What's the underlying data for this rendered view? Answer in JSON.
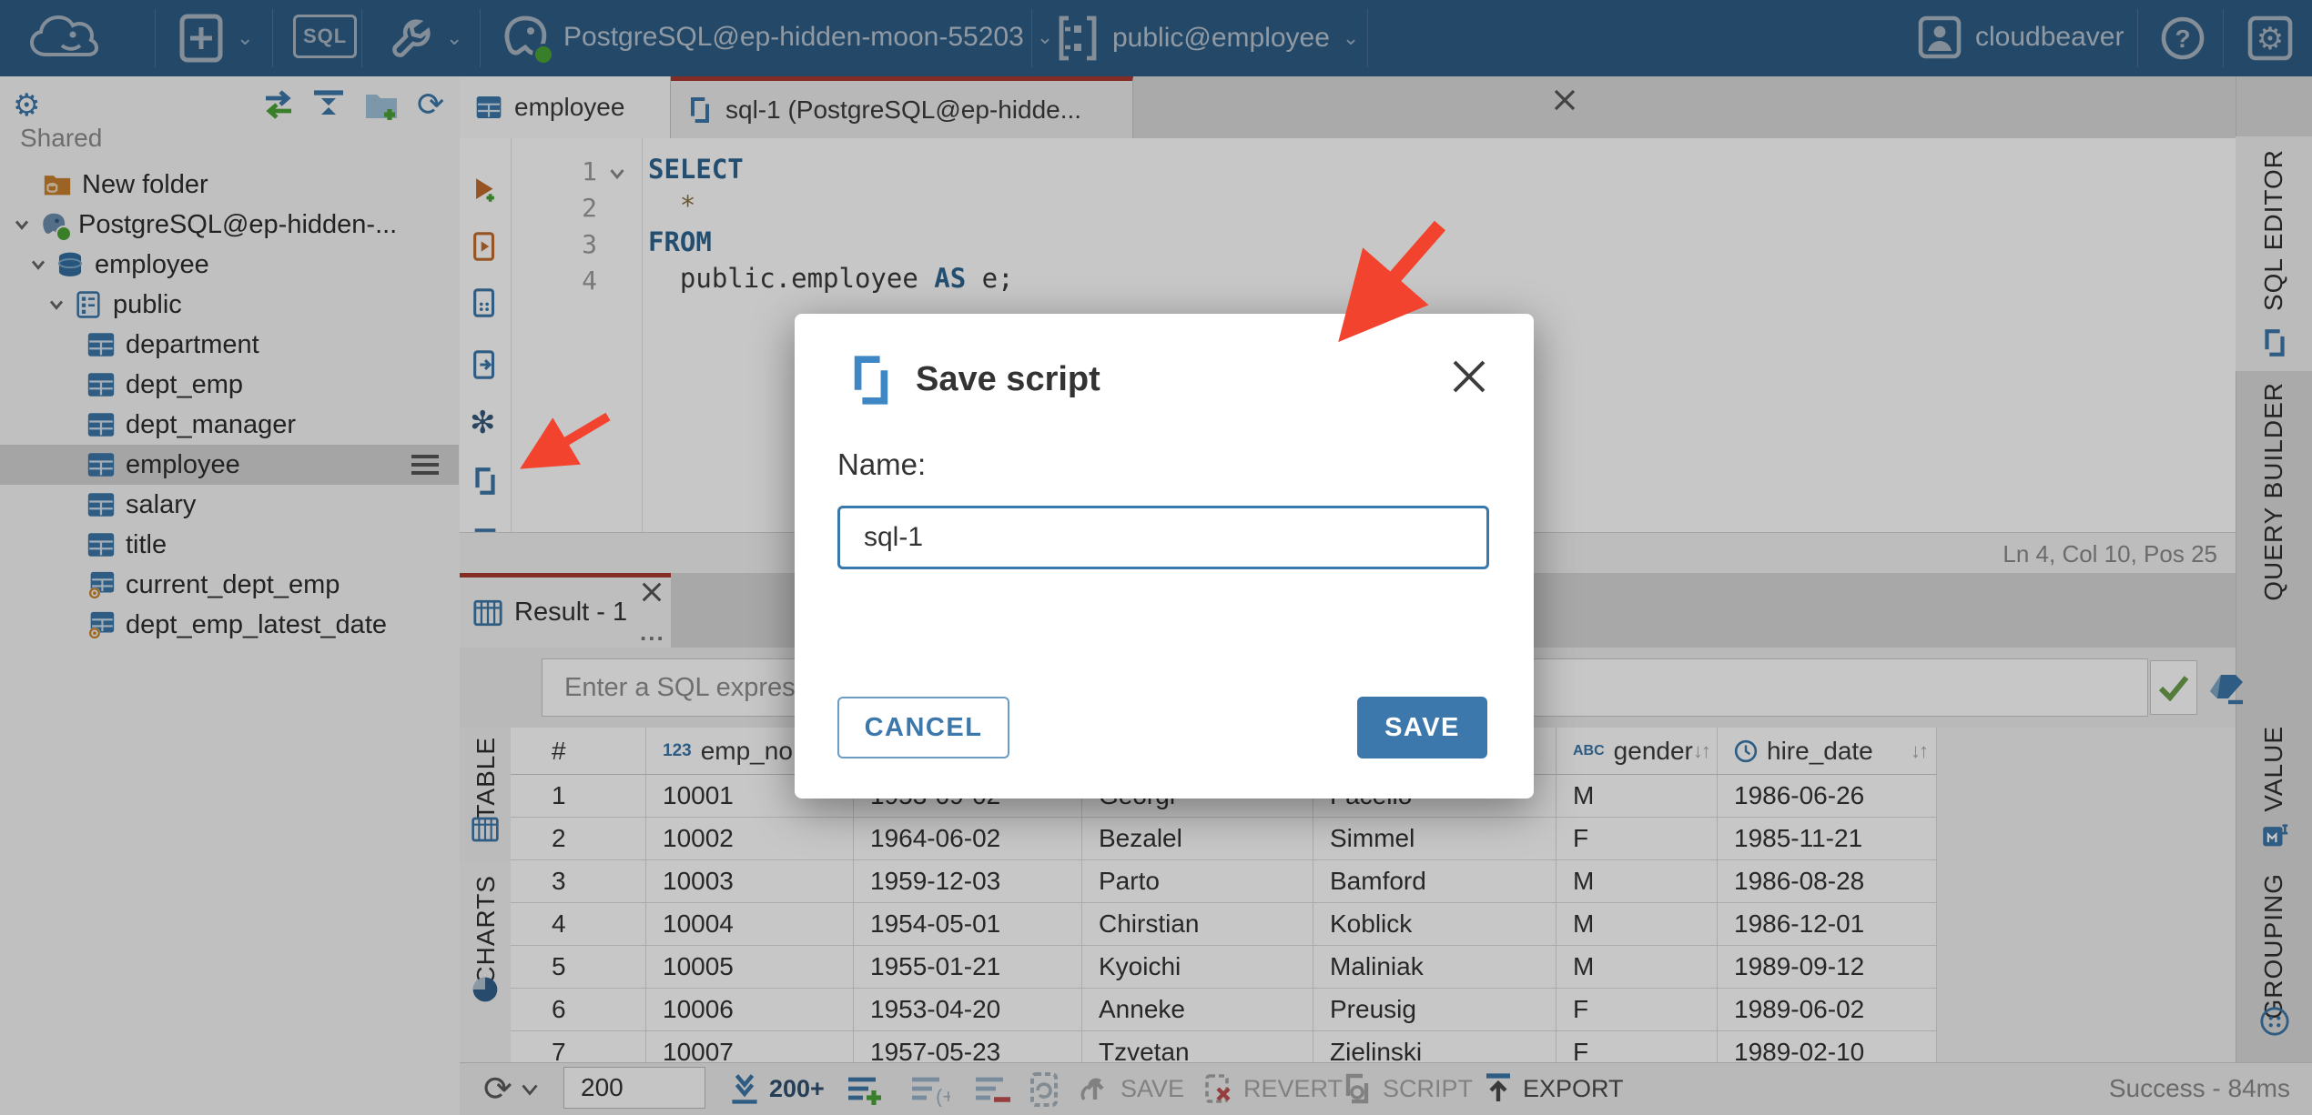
{
  "colors": {
    "accent": "#3c78ab",
    "topbar": "#2f5d86",
    "tab_indicator": "#a83a31",
    "status_green": "#4aa336",
    "arrow_red": "#f2432f"
  },
  "topbar": {
    "sql_badge": "SQL",
    "connection": "PostgreSQL@ep-hidden-moon-55203",
    "schema": "public@employee",
    "user": "cloudbeaver"
  },
  "sidebar": {
    "section_label": "Shared",
    "tree": [
      {
        "label": "New folder",
        "type": "folder"
      },
      {
        "label": "PostgreSQL@ep-hidden-...",
        "type": "connection",
        "expanded": true
      },
      {
        "label": "employee",
        "type": "database",
        "expanded": true
      },
      {
        "label": "public",
        "type": "schema",
        "expanded": true
      },
      {
        "label": "department",
        "type": "table"
      },
      {
        "label": "dept_emp",
        "type": "table"
      },
      {
        "label": "dept_manager",
        "type": "table"
      },
      {
        "label": "employee",
        "type": "table",
        "selected": true
      },
      {
        "label": "salary",
        "type": "table"
      },
      {
        "label": "title",
        "type": "table"
      },
      {
        "label": "current_dept_emp",
        "type": "view"
      },
      {
        "label": "dept_emp_latest_date",
        "type": "view"
      }
    ]
  },
  "editor_tabs": {
    "tab1": "employee",
    "tab2": "sql-1 (PostgreSQL@ep-hidde...",
    "menu_dots": "..."
  },
  "editor": {
    "line_numbers": [
      "1",
      "2",
      "3",
      "4"
    ],
    "kw_select": "SELECT",
    "star": "*",
    "kw_from": "FROM",
    "l4_plain1": "public.employee ",
    "kw_as": "AS",
    "l4_plain2": " e;",
    "status": "Ln 4, Col 10, Pos 25"
  },
  "result": {
    "tab_label": "Result - 1",
    "menu_dots": "...",
    "filter_placeholder": "Enter a SQL expressi",
    "table_tab": "TABLE",
    "charts_tab": "CHARTS"
  },
  "grid": {
    "headers": {
      "rownum": "#",
      "emp_no_type": "123",
      "emp_no": "emp_no",
      "gender_type": "ABC",
      "gender": "gender",
      "hire_date": "hire_date",
      "sort_glyph": "↓↑"
    },
    "rows": [
      [
        "1",
        "10001",
        "1953-09-02",
        "Georgi",
        "Facello",
        "M",
        "1986-06-26"
      ],
      [
        "2",
        "10002",
        "1964-06-02",
        "Bezalel",
        "Simmel",
        "F",
        "1985-11-21"
      ],
      [
        "3",
        "10003",
        "1959-12-03",
        "Parto",
        "Bamford",
        "M",
        "1986-08-28"
      ],
      [
        "4",
        "10004",
        "1954-05-01",
        "Chirstian",
        "Koblick",
        "M",
        "1986-12-01"
      ],
      [
        "5",
        "10005",
        "1955-01-21",
        "Kyoichi",
        "Maliniak",
        "M",
        "1989-09-12"
      ],
      [
        "6",
        "10006",
        "1953-04-20",
        "Anneke",
        "Preusig",
        "F",
        "1989-06-02"
      ],
      [
        "7",
        "10007",
        "1957-05-23",
        "Tzvetan",
        "Zielinski",
        "F",
        "1989-02-10"
      ]
    ]
  },
  "right_tabs": {
    "sql_editor": "SQL EDITOR",
    "query_builder": "QUERY BUILDER",
    "value": "VALUE",
    "grouping": "GROUPING"
  },
  "toolbar": {
    "rows_value": "200",
    "fetch_more": "200+",
    "save": "SAVE",
    "revert": "REVERT",
    "script": "SCRIPT",
    "export": "EXPORT",
    "status": "Success - 84ms"
  },
  "modal": {
    "title": "Save script",
    "name_label": "Name:",
    "input_value": "sql-1",
    "cancel": "CANCEL",
    "save": "SAVE"
  }
}
